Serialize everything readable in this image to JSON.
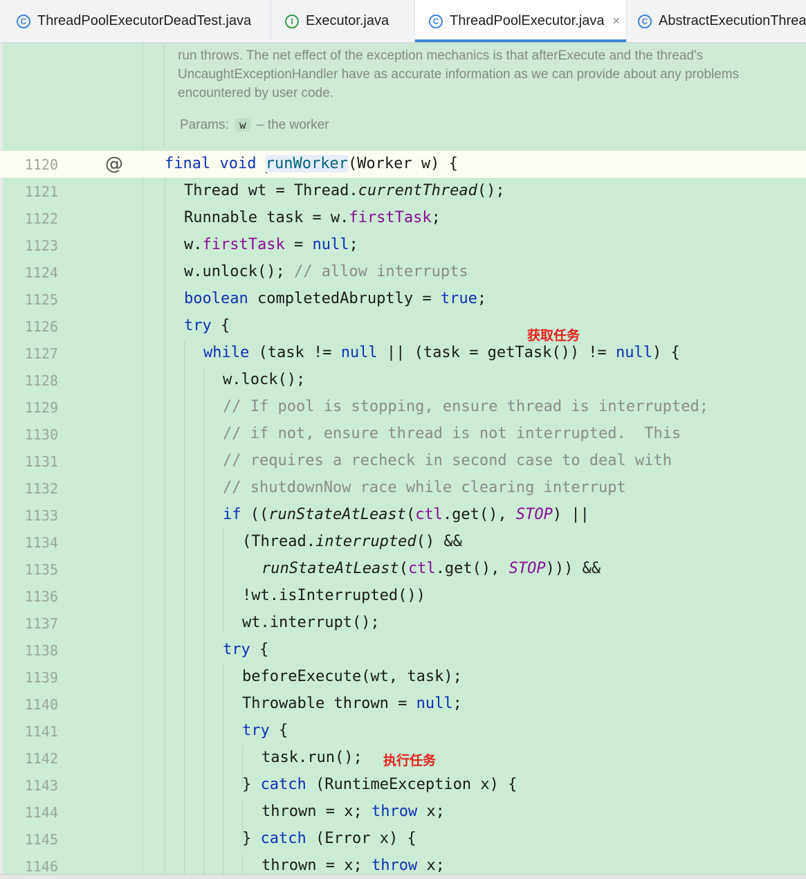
{
  "tabs": [
    {
      "label": "ThreadPoolExecutorDeadTest.java",
      "icon": "class-icon",
      "active": false
    },
    {
      "label": "Executor.java",
      "icon": "interface-icon",
      "active": false
    },
    {
      "label": "ThreadPoolExecutor.java",
      "icon": "class-icon",
      "active": true,
      "close": "×"
    },
    {
      "label": "AbstractExecutionThread",
      "icon": "class-icon",
      "active": false
    }
  ],
  "doc": {
    "line1": "run throws. The net effect of the exception mechanics is that afterExecute and the thread's",
    "line2": "UncaughtExceptionHandler have as accurate information as we can provide about any problems",
    "line3": "encountered by user code.",
    "params_label": "Params:",
    "param_name": "w",
    "param_desc": "– the worker"
  },
  "gutter_marker": "@",
  "annotations": {
    "get_task": "获取任务",
    "run_task": "执行任务"
  },
  "lines": [
    {
      "n": "1120"
    },
    {
      "n": "1121"
    },
    {
      "n": "1122"
    },
    {
      "n": "1123"
    },
    {
      "n": "1124"
    },
    {
      "n": "1125"
    },
    {
      "n": "1126"
    },
    {
      "n": "1127"
    },
    {
      "n": "1128"
    },
    {
      "n": "1129"
    },
    {
      "n": "1130"
    },
    {
      "n": "1131"
    },
    {
      "n": "1132"
    },
    {
      "n": "1133"
    },
    {
      "n": "1134"
    },
    {
      "n": "1135"
    },
    {
      "n": "1136"
    },
    {
      "n": "1137"
    },
    {
      "n": "1138"
    },
    {
      "n": "1139"
    },
    {
      "n": "1140"
    },
    {
      "n": "1141"
    },
    {
      "n": "1142"
    },
    {
      "n": "1143"
    },
    {
      "n": "1144"
    },
    {
      "n": "1145"
    },
    {
      "n": "1146"
    }
  ],
  "code": {
    "l1120": {
      "a": "final",
      "b": "void",
      "c": "runWorker",
      "d": "(Worker w) {"
    },
    "l1121": {
      "a": "Thread wt = Thread.",
      "b": "currentThread",
      "c": "();"
    },
    "l1122": {
      "a": "Runnable task = w.",
      "b": "firstTask",
      "c": ";"
    },
    "l1123": {
      "a": "w.",
      "b": "firstTask",
      "c": " = ",
      "d": "null",
      "e": ";"
    },
    "l1124": {
      "a": "w.unlock(); ",
      "b": "// allow interrupts"
    },
    "l1125": {
      "a": "boolean",
      "b": " completedAbruptly = ",
      "c": "true",
      "d": ";"
    },
    "l1126": {
      "a": "try",
      "b": " {"
    },
    "l1127": {
      "a": "while",
      "b": " (task != ",
      "c": "null",
      "d": " || (task = getTask()) != ",
      "e": "null",
      "f": ") {"
    },
    "l1128": {
      "a": "w.lock();"
    },
    "l1129": {
      "a": "// If pool is stopping, ensure thread is interrupted;"
    },
    "l1130": {
      "a": "// if not, ensure thread is not interrupted.  This"
    },
    "l1131": {
      "a": "// requires a recheck in second case to deal with"
    },
    "l1132": {
      "a": "// shutdownNow race while clearing interrupt"
    },
    "l1133": {
      "a": "if",
      "b": " ((",
      "c": "runStateAtLeast",
      "d": "(",
      "e": "ctl",
      "f": ".get(), ",
      "g": "STOP",
      "h": ") ||"
    },
    "l1134": {
      "a": "(Thread.",
      "b": "interrupted",
      "c": "() &&"
    },
    "l1135": {
      "a": "runStateAtLeast",
      "b": "(",
      "c": "ctl",
      "d": ".get(), ",
      "e": "STOP",
      "f": "))) &&"
    },
    "l1136": {
      "a": "!wt.isInterrupted())"
    },
    "l1137": {
      "a": "wt.interrupt();"
    },
    "l1138": {
      "a": "try",
      "b": " {"
    },
    "l1139": {
      "a": "beforeExecute(wt, task);"
    },
    "l1140": {
      "a": "Throwable thrown = ",
      "b": "null",
      "c": ";"
    },
    "l1141": {
      "a": "try",
      "b": " {"
    },
    "l1142": {
      "a": "task.run();"
    },
    "l1143": {
      "a": "} ",
      "b": "catch",
      "c": " (RuntimeException x) {"
    },
    "l1144": {
      "a": "thrown = x; ",
      "b": "throw",
      "c": " x;"
    },
    "l1145": {
      "a": "} ",
      "b": "catch",
      "c": " (Error x) {"
    },
    "l1146": {
      "a": "thrown = x; ",
      "b": "throw",
      "c": " x;"
    }
  },
  "colors": {
    "background": "#ccebd4",
    "keyword": "#0c33b3",
    "field": "#871094",
    "comment": "#8c8c8c",
    "annotation": "#e8201a",
    "tab_accent": "#3f86d8"
  }
}
